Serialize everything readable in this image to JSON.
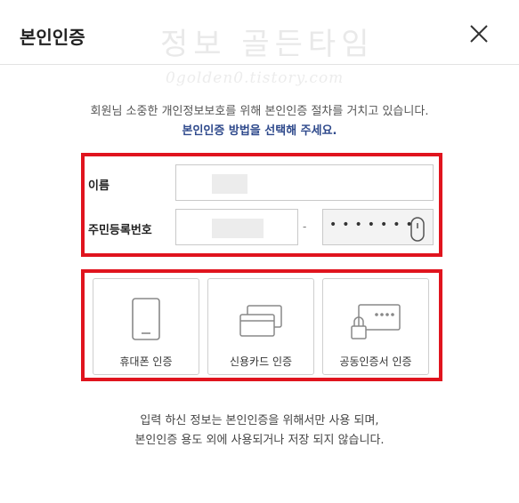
{
  "header": {
    "title": "본인인증"
  },
  "watermark": {
    "line1": "정보 골든타임",
    "line2": "0golden0.tistory.com"
  },
  "intro": {
    "line1": "회원님 소중한 개인정보보호를 위해 본인인증 절차를 거치고 있습니다.",
    "line2": "본인인증 방법을 선택해 주세요."
  },
  "form": {
    "name_label": "이름",
    "rrn_label": "주민등록번호",
    "separator": "-",
    "masked_back": "•••••••"
  },
  "methods": [
    {
      "label": "휴대폰 인증",
      "icon": "phone-icon"
    },
    {
      "label": "신용카드 인증",
      "icon": "credit-card-icon"
    },
    {
      "label": "공동인증서 인증",
      "icon": "certificate-icon"
    }
  ],
  "notice": {
    "line1": "입력 하신 정보는 본인인증을 위해서만 사용 되며,",
    "line2": "본인인증 용도 외에 사용되거나 저장 되지 않습니다."
  },
  "colors": {
    "highlight": "#e0141e",
    "link": "#2f4a8c"
  }
}
